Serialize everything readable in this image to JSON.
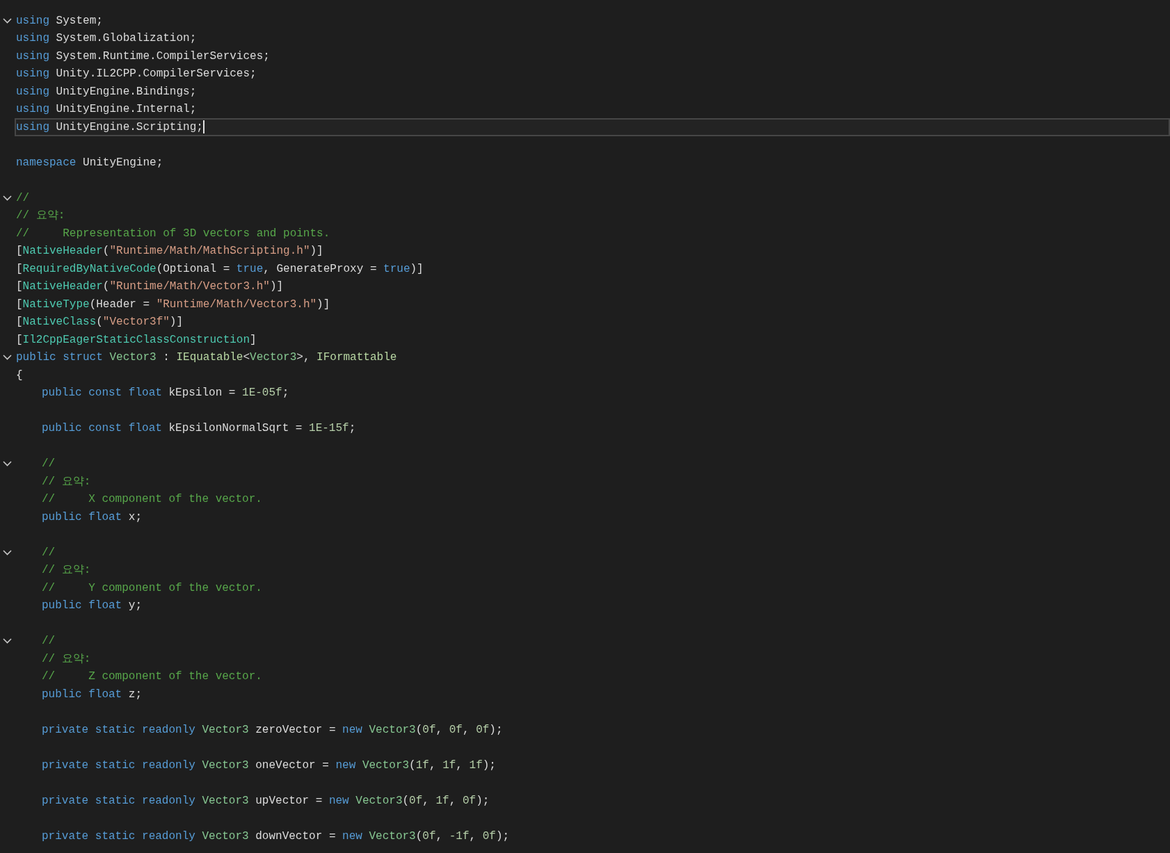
{
  "lines": [
    {
      "kind": "code",
      "fold": true,
      "current": false,
      "indented": false,
      "tokens": [
        {
          "kind": "kw",
          "text": "using"
        },
        {
          "kind": "p",
          "text": " System;"
        }
      ]
    },
    {
      "kind": "code",
      "fold": false,
      "current": false,
      "indented": false,
      "tokens": [
        {
          "kind": "kw",
          "text": "using"
        },
        {
          "kind": "p",
          "text": " System.Globalization;"
        }
      ]
    },
    {
      "kind": "code",
      "fold": false,
      "current": false,
      "indented": false,
      "tokens": [
        {
          "kind": "kw",
          "text": "using"
        },
        {
          "kind": "p",
          "text": " System.Runtime.CompilerServices;"
        }
      ]
    },
    {
      "kind": "code",
      "fold": false,
      "current": false,
      "indented": false,
      "tokens": [
        {
          "kind": "kw",
          "text": "using"
        },
        {
          "kind": "p",
          "text": " Unity.IL2CPP.CompilerServices;"
        }
      ]
    },
    {
      "kind": "code",
      "fold": false,
      "current": false,
      "indented": false,
      "tokens": [
        {
          "kind": "kw",
          "text": "using"
        },
        {
          "kind": "p",
          "text": " UnityEngine.Bindings;"
        }
      ]
    },
    {
      "kind": "code",
      "fold": false,
      "current": false,
      "indented": false,
      "tokens": [
        {
          "kind": "kw",
          "text": "using"
        },
        {
          "kind": "p",
          "text": " UnityEngine.Internal;"
        }
      ]
    },
    {
      "kind": "code",
      "fold": false,
      "current": true,
      "indented": false,
      "tokens": [
        {
          "kind": "kw",
          "text": "using"
        },
        {
          "kind": "p",
          "text": " UnityEngine.Scripting;"
        }
      ]
    },
    {
      "kind": "blank"
    },
    {
      "kind": "code",
      "fold": false,
      "current": false,
      "indented": false,
      "tokens": [
        {
          "kind": "kw",
          "text": "namespace"
        },
        {
          "kind": "p",
          "text": " UnityEngine;"
        }
      ]
    },
    {
      "kind": "blank"
    },
    {
      "kind": "code",
      "fold": true,
      "current": false,
      "indented": false,
      "tokens": [
        {
          "kind": "c",
          "text": "//"
        }
      ]
    },
    {
      "kind": "code",
      "fold": false,
      "current": false,
      "indented": false,
      "tokens": [
        {
          "kind": "c",
          "text": "// 요약:"
        }
      ]
    },
    {
      "kind": "code",
      "fold": false,
      "current": false,
      "indented": false,
      "tokens": [
        {
          "kind": "c",
          "text": "//     Representation of 3D vectors and points."
        }
      ]
    },
    {
      "kind": "code",
      "fold": false,
      "current": false,
      "indented": false,
      "tokens": [
        {
          "kind": "p",
          "text": "["
        },
        {
          "kind": "attr",
          "text": "NativeHeader"
        },
        {
          "kind": "p",
          "text": "("
        },
        {
          "kind": "s",
          "text": "\"Runtime/Math/MathScripting.h\""
        },
        {
          "kind": "p",
          "text": ")]"
        }
      ]
    },
    {
      "kind": "code",
      "fold": false,
      "current": false,
      "indented": false,
      "tokens": [
        {
          "kind": "p",
          "text": "["
        },
        {
          "kind": "attr",
          "text": "RequiredByNativeCode"
        },
        {
          "kind": "p",
          "text": "(Optional = "
        },
        {
          "kind": "kw",
          "text": "true"
        },
        {
          "kind": "p",
          "text": ", GenerateProxy = "
        },
        {
          "kind": "kw",
          "text": "true"
        },
        {
          "kind": "p",
          "text": ")]"
        }
      ]
    },
    {
      "kind": "code",
      "fold": false,
      "current": false,
      "indented": false,
      "tokens": [
        {
          "kind": "p",
          "text": "["
        },
        {
          "kind": "attr",
          "text": "NativeHeader"
        },
        {
          "kind": "p",
          "text": "("
        },
        {
          "kind": "s",
          "text": "\"Runtime/Math/Vector3.h\""
        },
        {
          "kind": "p",
          "text": ")]"
        }
      ]
    },
    {
      "kind": "code",
      "fold": false,
      "current": false,
      "indented": false,
      "tokens": [
        {
          "kind": "p",
          "text": "["
        },
        {
          "kind": "attr",
          "text": "NativeType"
        },
        {
          "kind": "p",
          "text": "(Header = "
        },
        {
          "kind": "s",
          "text": "\"Runtime/Math/Vector3.h\""
        },
        {
          "kind": "p",
          "text": ")]"
        }
      ]
    },
    {
      "kind": "code",
      "fold": false,
      "current": false,
      "indented": false,
      "tokens": [
        {
          "kind": "p",
          "text": "["
        },
        {
          "kind": "attr",
          "text": "NativeClass"
        },
        {
          "kind": "p",
          "text": "("
        },
        {
          "kind": "s",
          "text": "\"Vector3f\""
        },
        {
          "kind": "p",
          "text": ")]"
        }
      ]
    },
    {
      "kind": "code",
      "fold": false,
      "current": false,
      "indented": false,
      "tokens": [
        {
          "kind": "p",
          "text": "["
        },
        {
          "kind": "attr",
          "text": "Il2CppEagerStaticClassConstruction"
        },
        {
          "kind": "p",
          "text": "]"
        }
      ]
    },
    {
      "kind": "code",
      "fold": true,
      "current": false,
      "indented": false,
      "tokens": [
        {
          "kind": "kw",
          "text": "public struct"
        },
        {
          "kind": "t",
          "text": " Vector3"
        },
        {
          "kind": "p",
          "text": " : "
        },
        {
          "kind": "i",
          "text": "IEquatable"
        },
        {
          "kind": "p",
          "text": "<"
        },
        {
          "kind": "t",
          "text": "Vector3"
        },
        {
          "kind": "p",
          "text": ">, "
        },
        {
          "kind": "i",
          "text": "IFormattable"
        }
      ]
    },
    {
      "kind": "code",
      "fold": false,
      "current": false,
      "indented": false,
      "tokens": [
        {
          "kind": "p",
          "text": "{"
        }
      ]
    },
    {
      "kind": "code",
      "fold": false,
      "current": false,
      "indented": true,
      "tokens": [
        {
          "kind": "kw",
          "text": "public const float"
        },
        {
          "kind": "p",
          "text": " kEpsilon = "
        },
        {
          "kind": "n",
          "text": "1E-05f"
        },
        {
          "kind": "p",
          "text": ";"
        }
      ]
    },
    {
      "kind": "blank"
    },
    {
      "kind": "code",
      "fold": false,
      "current": false,
      "indented": true,
      "tokens": [
        {
          "kind": "kw",
          "text": "public const float"
        },
        {
          "kind": "p",
          "text": " kEpsilonNormalSqrt = "
        },
        {
          "kind": "n",
          "text": "1E-15f"
        },
        {
          "kind": "p",
          "text": ";"
        }
      ]
    },
    {
      "kind": "blank"
    },
    {
      "kind": "code",
      "fold": true,
      "current": false,
      "indented": true,
      "tokens": [
        {
          "kind": "c",
          "text": "//"
        }
      ]
    },
    {
      "kind": "code",
      "fold": false,
      "current": false,
      "indented": true,
      "tokens": [
        {
          "kind": "c",
          "text": "// 요약:"
        }
      ]
    },
    {
      "kind": "code",
      "fold": false,
      "current": false,
      "indented": true,
      "tokens": [
        {
          "kind": "c",
          "text": "//     X component of the vector."
        }
      ]
    },
    {
      "kind": "code",
      "fold": false,
      "current": false,
      "indented": true,
      "tokens": [
        {
          "kind": "kw",
          "text": "public float"
        },
        {
          "kind": "p",
          "text": " x;"
        }
      ]
    },
    {
      "kind": "blank"
    },
    {
      "kind": "code",
      "fold": true,
      "current": false,
      "indented": true,
      "tokens": [
        {
          "kind": "c",
          "text": "//"
        }
      ]
    },
    {
      "kind": "code",
      "fold": false,
      "current": false,
      "indented": true,
      "tokens": [
        {
          "kind": "c",
          "text": "// 요약:"
        }
      ]
    },
    {
      "kind": "code",
      "fold": false,
      "current": false,
      "indented": true,
      "tokens": [
        {
          "kind": "c",
          "text": "//     Y component of the vector."
        }
      ]
    },
    {
      "kind": "code",
      "fold": false,
      "current": false,
      "indented": true,
      "tokens": [
        {
          "kind": "kw",
          "text": "public float"
        },
        {
          "kind": "p",
          "text": " y;"
        }
      ]
    },
    {
      "kind": "blank"
    },
    {
      "kind": "code",
      "fold": true,
      "current": false,
      "indented": true,
      "tokens": [
        {
          "kind": "c",
          "text": "//"
        }
      ]
    },
    {
      "kind": "code",
      "fold": false,
      "current": false,
      "indented": true,
      "tokens": [
        {
          "kind": "c",
          "text": "// 요약:"
        }
      ]
    },
    {
      "kind": "code",
      "fold": false,
      "current": false,
      "indented": true,
      "tokens": [
        {
          "kind": "c",
          "text": "//     Z component of the vector."
        }
      ]
    },
    {
      "kind": "code",
      "fold": false,
      "current": false,
      "indented": true,
      "tokens": [
        {
          "kind": "kw",
          "text": "public float"
        },
        {
          "kind": "p",
          "text": " z;"
        }
      ]
    },
    {
      "kind": "blank"
    },
    {
      "kind": "code",
      "fold": false,
      "current": false,
      "indented": true,
      "tokens": [
        {
          "kind": "kw",
          "text": "private static readonly"
        },
        {
          "kind": "t",
          "text": " Vector3"
        },
        {
          "kind": "p",
          "text": " zeroVector = "
        },
        {
          "kind": "kw",
          "text": "new"
        },
        {
          "kind": "t",
          "text": " Vector3"
        },
        {
          "kind": "p",
          "text": "("
        },
        {
          "kind": "n",
          "text": "0f"
        },
        {
          "kind": "p",
          "text": ", "
        },
        {
          "kind": "n",
          "text": "0f"
        },
        {
          "kind": "p",
          "text": ", "
        },
        {
          "kind": "n",
          "text": "0f"
        },
        {
          "kind": "p",
          "text": ");"
        }
      ]
    },
    {
      "kind": "blank"
    },
    {
      "kind": "code",
      "fold": false,
      "current": false,
      "indented": true,
      "tokens": [
        {
          "kind": "kw",
          "text": "private static readonly"
        },
        {
          "kind": "t",
          "text": " Vector3"
        },
        {
          "kind": "p",
          "text": " oneVector = "
        },
        {
          "kind": "kw",
          "text": "new"
        },
        {
          "kind": "t",
          "text": " Vector3"
        },
        {
          "kind": "p",
          "text": "("
        },
        {
          "kind": "n",
          "text": "1f"
        },
        {
          "kind": "p",
          "text": ", "
        },
        {
          "kind": "n",
          "text": "1f"
        },
        {
          "kind": "p",
          "text": ", "
        },
        {
          "kind": "n",
          "text": "1f"
        },
        {
          "kind": "p",
          "text": ");"
        }
      ]
    },
    {
      "kind": "blank"
    },
    {
      "kind": "code",
      "fold": false,
      "current": false,
      "indented": true,
      "tokens": [
        {
          "kind": "kw",
          "text": "private static readonly"
        },
        {
          "kind": "t",
          "text": " Vector3"
        },
        {
          "kind": "p",
          "text": " upVector = "
        },
        {
          "kind": "kw",
          "text": "new"
        },
        {
          "kind": "t",
          "text": " Vector3"
        },
        {
          "kind": "p",
          "text": "("
        },
        {
          "kind": "n",
          "text": "0f"
        },
        {
          "kind": "p",
          "text": ", "
        },
        {
          "kind": "n",
          "text": "1f"
        },
        {
          "kind": "p",
          "text": ", "
        },
        {
          "kind": "n",
          "text": "0f"
        },
        {
          "kind": "p",
          "text": ");"
        }
      ]
    },
    {
      "kind": "blank"
    },
    {
      "kind": "code",
      "fold": false,
      "current": false,
      "indented": true,
      "tokens": [
        {
          "kind": "kw",
          "text": "private static readonly"
        },
        {
          "kind": "t",
          "text": " Vector3"
        },
        {
          "kind": "p",
          "text": " downVector = "
        },
        {
          "kind": "kw",
          "text": "new"
        },
        {
          "kind": "t",
          "text": " Vector3"
        },
        {
          "kind": "p",
          "text": "("
        },
        {
          "kind": "n",
          "text": "0f"
        },
        {
          "kind": "p",
          "text": ", "
        },
        {
          "kind": "n",
          "text": "-1f"
        },
        {
          "kind": "p",
          "text": ", "
        },
        {
          "kind": "n",
          "text": "0f"
        },
        {
          "kind": "p",
          "text": ");"
        }
      ]
    }
  ]
}
